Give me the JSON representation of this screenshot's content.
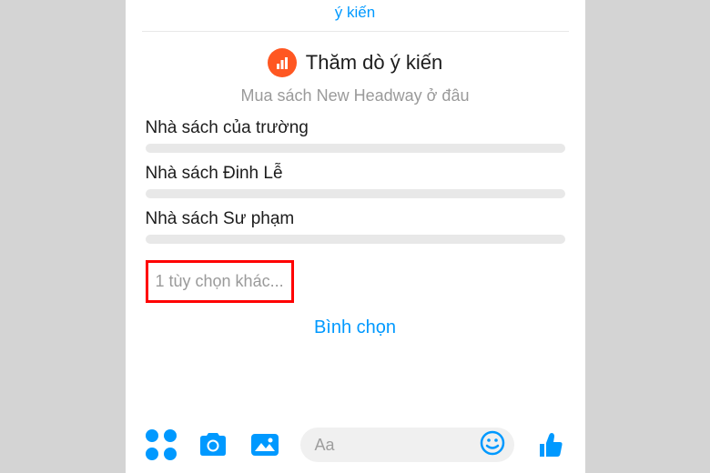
{
  "header": {
    "link_text": "ý kiến"
  },
  "poll": {
    "title": "Thăm dò ý kiến",
    "question": "Mua sách New Headway ở đâu",
    "options": [
      "Nhà sách của trường",
      "Nhà sách Đinh Lễ",
      "Nhà sách Sư phạm"
    ],
    "more_options_text": "1 tùy chọn khác...",
    "vote_button": "Bình chọn"
  },
  "composer": {
    "placeholder": "Aa"
  },
  "colors": {
    "accent": "#0099ff",
    "poll_icon": "#ff5722",
    "highlight_border": "#ff0000"
  }
}
